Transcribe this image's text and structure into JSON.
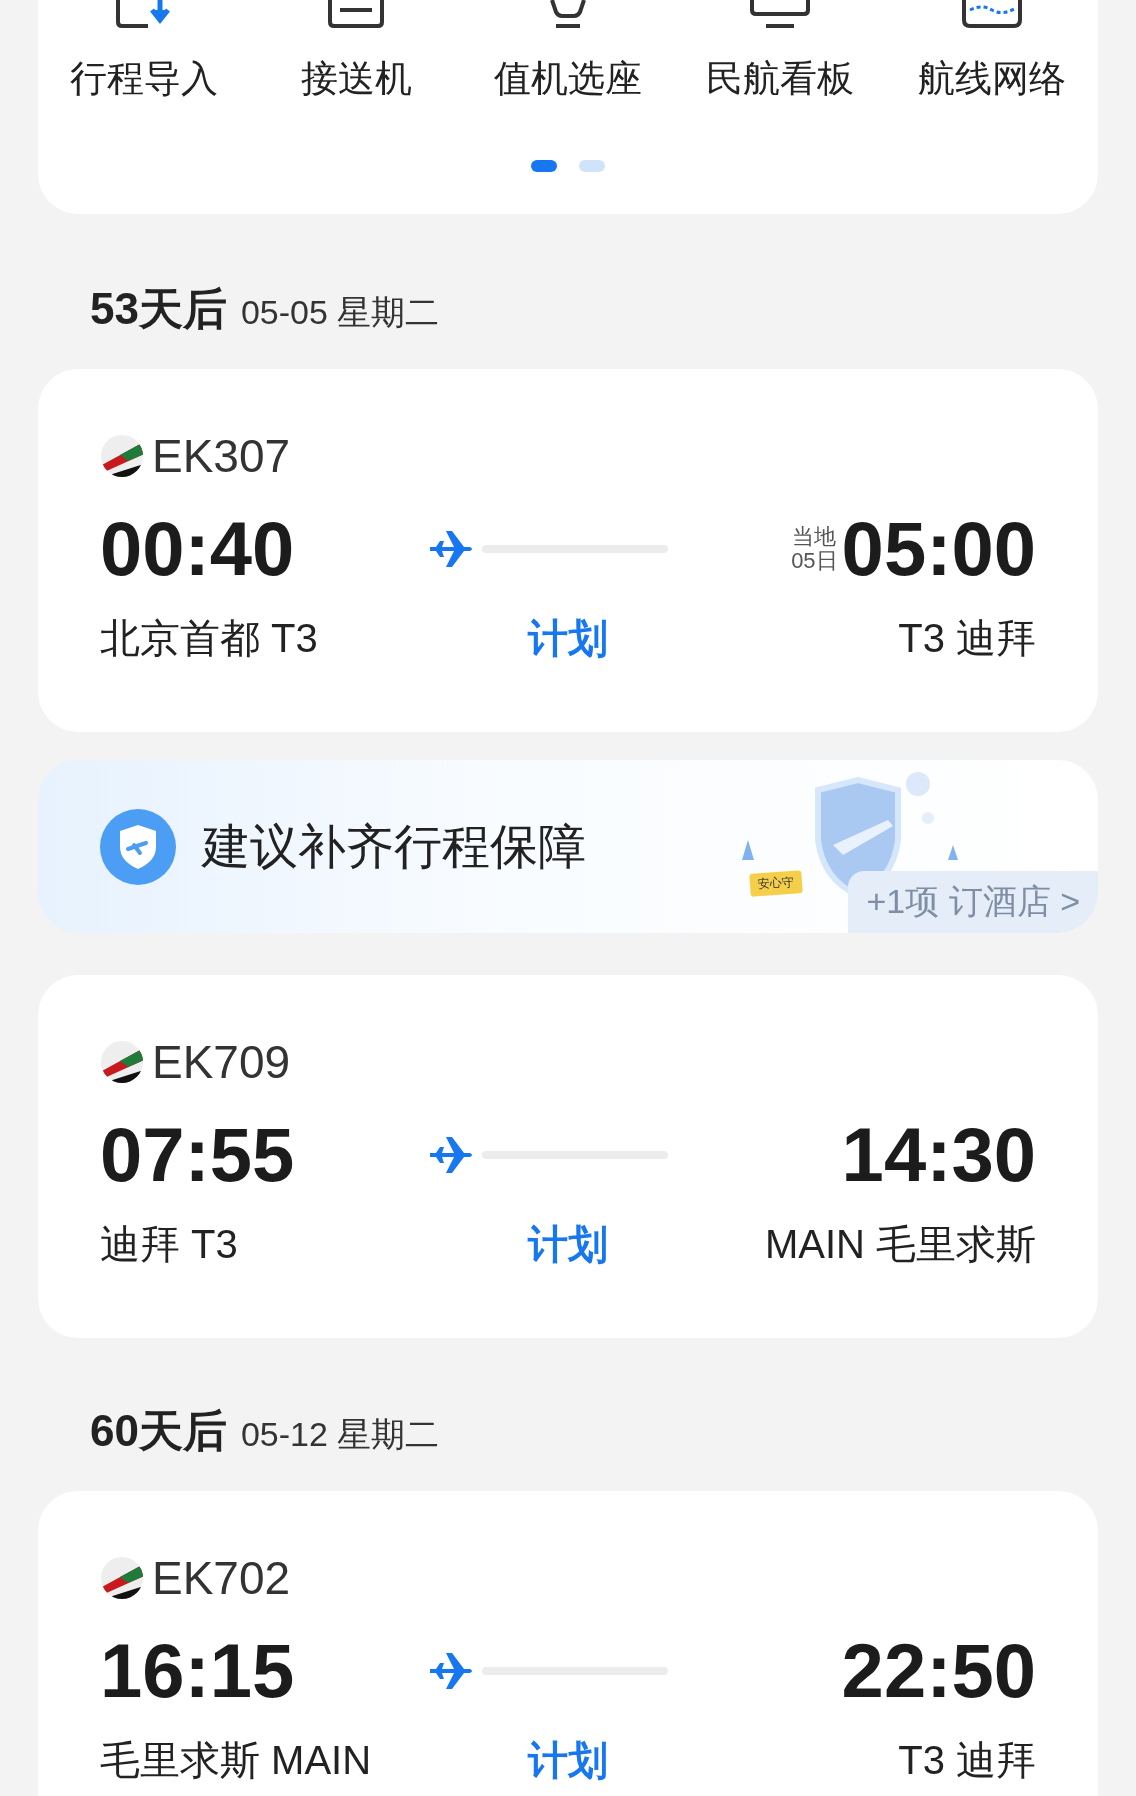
{
  "quick_menu": {
    "items": [
      {
        "label": "行程导入"
      },
      {
        "label": "接送机"
      },
      {
        "label": "值机选座"
      },
      {
        "label": "民航看板"
      },
      {
        "label": "航线网络"
      }
    ],
    "pager": [
      {
        "selected": true
      },
      {
        "selected": false
      }
    ]
  },
  "sections": [
    {
      "days": "53天后",
      "date": "05-05 星期二",
      "items": [
        {
          "kind": "flight",
          "number": "EK307",
          "dep_time": "00:40",
          "dep_airport": "北京首都 T3",
          "status": "计划",
          "arr_note": [
            "当地",
            "05日"
          ],
          "arr_time": "05:00",
          "arr_airport": "T3 迪拜"
        },
        {
          "kind": "promo",
          "title": "建议补齐行程保障",
          "badge": "安心守",
          "action": "+1项 订酒店 >"
        },
        {
          "kind": "flight",
          "number": "EK709",
          "dep_time": "07:55",
          "dep_airport": "迪拜 T3",
          "status": "计划",
          "arr_time": "14:30",
          "arr_airport": "MAIN 毛里求斯"
        }
      ]
    },
    {
      "days": "60天后",
      "date": "05-12 星期二",
      "items": [
        {
          "kind": "flight",
          "number": "EK702",
          "dep_time": "16:15",
          "dep_airport": "毛里求斯 MAIN",
          "status": "计划",
          "arr_time": "22:50",
          "arr_airport": "T3 迪拜"
        }
      ]
    }
  ]
}
